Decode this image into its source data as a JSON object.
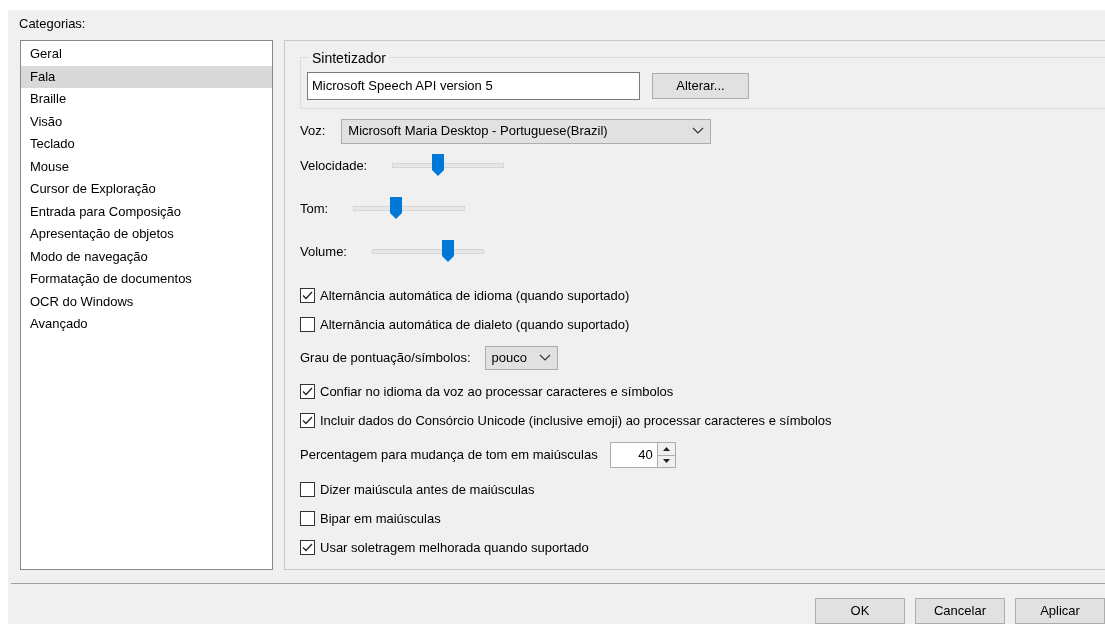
{
  "categories": {
    "label": "Categorias:",
    "items": [
      {
        "label": "Geral",
        "selected": false
      },
      {
        "label": "Fala",
        "selected": true
      },
      {
        "label": "Braille",
        "selected": false
      },
      {
        "label": "Visão",
        "selected": false
      },
      {
        "label": "Teclado",
        "selected": false
      },
      {
        "label": "Mouse",
        "selected": false
      },
      {
        "label": "Cursor de Exploração",
        "selected": false
      },
      {
        "label": "Entrada para Composição",
        "selected": false
      },
      {
        "label": "Apresentação de objetos",
        "selected": false
      },
      {
        "label": "Modo de navegação",
        "selected": false
      },
      {
        "label": "Formatação de documentos",
        "selected": false
      },
      {
        "label": "OCR do Windows",
        "selected": false
      },
      {
        "label": "Avançado",
        "selected": false
      }
    ]
  },
  "synthesizer": {
    "group_title": "Sintetizador",
    "value": "Microsoft Speech API version 5",
    "button": "Alterar..."
  },
  "voice": {
    "label": "Voz:",
    "value": "Microsoft Maria Desktop - Portuguese(Brazil)"
  },
  "sliders": [
    {
      "label": "Velocidade:",
      "level": 0.41
    },
    {
      "label": "Tom:",
      "level": 0.38
    },
    {
      "label": "Volume:",
      "level": 0.68
    }
  ],
  "options": [
    {
      "kind": "checkbox",
      "label": "Alternância automática de idioma (quando suportado)",
      "checked": true
    },
    {
      "kind": "checkbox",
      "label": "Alternância automática de dialeto (quando suportado)",
      "checked": false
    },
    {
      "kind": "combo",
      "label": "Grau de pontuação/símbolos:",
      "value": "pouco"
    },
    {
      "kind": "checkbox",
      "label": "Confiar no idioma da voz ao processar caracteres e símbolos",
      "checked": true
    },
    {
      "kind": "checkbox",
      "label": "Incluir dados do Consórcio Unicode (inclusive emoji) ao processar caracteres e símbolos",
      "checked": true
    },
    {
      "kind": "spin",
      "label": "Percentagem para mudança de tom em maiúsculas",
      "value": "40"
    },
    {
      "kind": "checkbox",
      "label": "Dizer maiúscula antes de maiúsculas",
      "checked": false
    },
    {
      "kind": "checkbox",
      "label": "Bipar em maiúsculas",
      "checked": false
    },
    {
      "kind": "checkbox",
      "label": "Usar soletragem melhorada quando suportado",
      "checked": true
    }
  ],
  "buttons": [
    "OK",
    "Cancelar",
    "Aplicar"
  ]
}
